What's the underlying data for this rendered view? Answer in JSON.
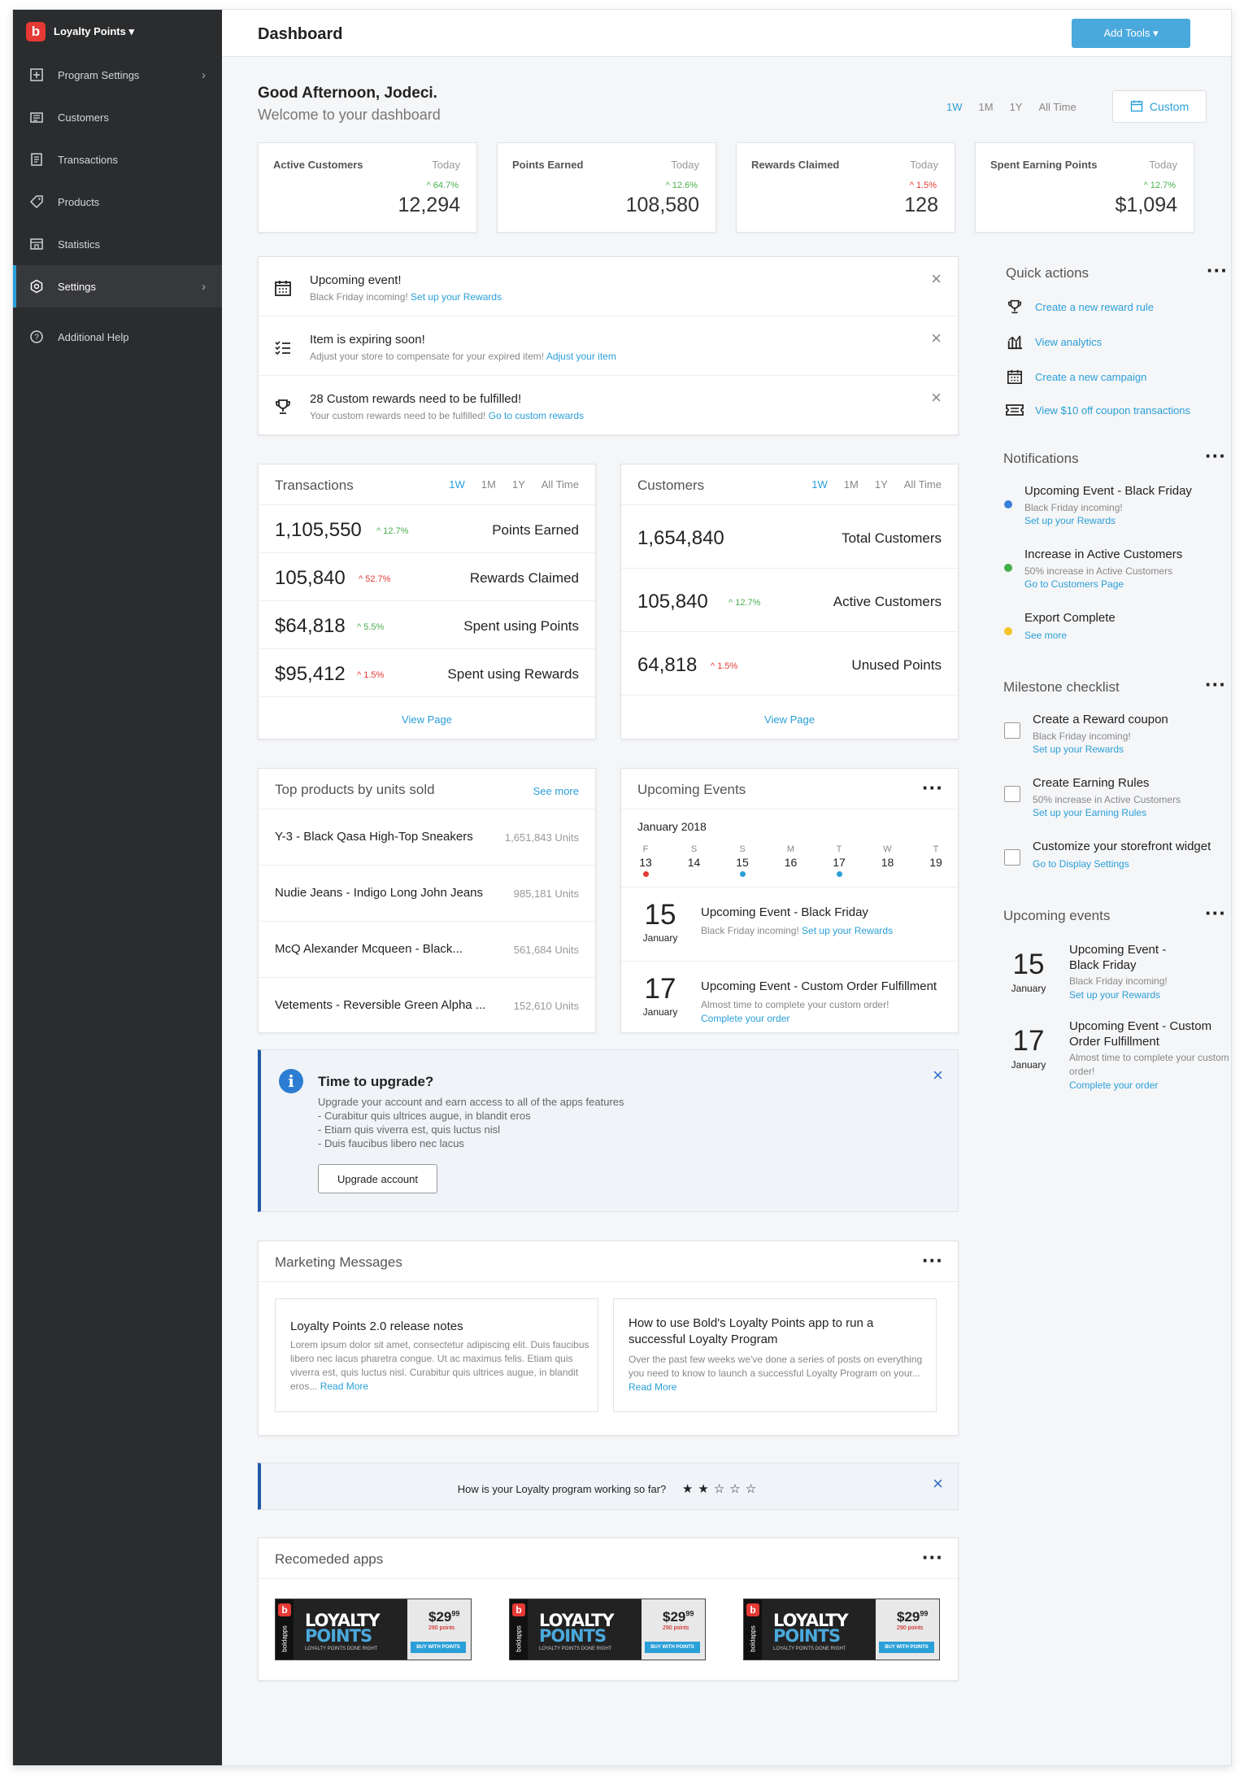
{
  "sidebar": {
    "brand": "Loyalty Points ▾",
    "items": [
      {
        "label": "Program Settings"
      },
      {
        "label": "Customers"
      },
      {
        "label": "Transactions"
      },
      {
        "label": "Products"
      },
      {
        "label": "Statistics"
      },
      {
        "label": "Settings"
      },
      {
        "label": "Additional Help"
      }
    ]
  },
  "header": {
    "title": "Dashboard",
    "add_tools": "Add Tools ▾"
  },
  "greeting": {
    "title": "Good Afternoon, Jodeci.",
    "subtitle": "Welcome to your dashboard"
  },
  "ranges": [
    "1W",
    "1M",
    "1Y",
    "All Time"
  ],
  "custom_label": "Custom",
  "stats": [
    {
      "label": "Active Customers",
      "period": "Today",
      "change": "^ 64.7%",
      "value": "12,294",
      "trend": "up"
    },
    {
      "label": "Points Earned",
      "period": "Today",
      "change": "^ 12.6%",
      "value": "108,580",
      "trend": "up"
    },
    {
      "label": "Rewards Claimed",
      "period": "Today",
      "change": "^ 1.5%",
      "value": "128",
      "trend": "down"
    },
    {
      "label": "Spent Earning Points",
      "period": "Today",
      "change": "^ 12.7%",
      "value": "$1,094",
      "trend": "up"
    }
  ],
  "alerts": [
    {
      "title": "Upcoming event!",
      "desc": "Black Friday incoming! ",
      "link": "Set up your Rewards"
    },
    {
      "title": "Item is expiring soon!",
      "desc": "Adjust your store to compensate for your expired item! ",
      "link": "Adjust your item"
    },
    {
      "title": "28 Custom rewards need to be fulfilled!",
      "desc": "Your custom rewards need to be fulfilled! ",
      "link": "Go to custom rewards"
    }
  ],
  "transactions": {
    "title": "Transactions",
    "rows": [
      {
        "value": "1,105,550",
        "change": "^ 12.7%",
        "trend": "up",
        "label": "Points Earned"
      },
      {
        "value": "105,840",
        "change": "^ 52.7%",
        "trend": "down",
        "label": "Rewards Claimed"
      },
      {
        "value": "$64,818",
        "change": "^ 5.5%",
        "trend": "up",
        "label": "Spent using Points"
      },
      {
        "value": "$95,412",
        "change": "^ 1.5%",
        "trend": "down",
        "label": "Spent using Rewards"
      }
    ],
    "view_page": "View Page"
  },
  "customers": {
    "title": "Customers",
    "rows": [
      {
        "value": "1,654,840",
        "change": "",
        "trend": "up",
        "label": "Total Customers"
      },
      {
        "value": "105,840",
        "change": "^ 12.7%",
        "trend": "up",
        "label": "Active Customers"
      },
      {
        "value": "64,818",
        "change": "^ 1.5%",
        "trend": "down",
        "label": "Unused Points"
      }
    ],
    "view_page": "View Page"
  },
  "top_products": {
    "title": "Top products by units sold",
    "see_more": "See more",
    "rows": [
      {
        "name": "Y-3 - Black Qasa High-Top Sneakers",
        "units": "1,651,843 Units"
      },
      {
        "name": "Nudie Jeans - Indigo Long John Jeans",
        "units": "985,181 Units"
      },
      {
        "name": "McQ Alexander Mcqueen - Black...",
        "units": "561,684 Units"
      },
      {
        "name": "Vetements - Reversible Green Alpha ...",
        "units": "152,610 Units"
      }
    ]
  },
  "upcoming_events": {
    "title": "Upcoming Events",
    "month": "January 2018",
    "days": [
      {
        "d": "F",
        "n": "13",
        "dot": "#e53935"
      },
      {
        "d": "S",
        "n": "14",
        "dot": ""
      },
      {
        "d": "S",
        "n": "15",
        "dot": "#2a9fd8"
      },
      {
        "d": "M",
        "n": "16",
        "dot": ""
      },
      {
        "d": "T",
        "n": "17",
        "dot": "#2a9fd8"
      },
      {
        "d": "W",
        "n": "18",
        "dot": ""
      },
      {
        "d": "T",
        "n": "19",
        "dot": ""
      }
    ],
    "events": [
      {
        "day": "15",
        "month": "January",
        "title": "Upcoming Event - Black Friday",
        "desc": "Black Friday incoming! ",
        "link": "Set up your Rewards"
      },
      {
        "day": "17",
        "month": "January",
        "title": "Upcoming Event - Custom Order Fulfillment",
        "desc": "Almost time to complete your custom order!",
        "link": "Complete your order"
      }
    ]
  },
  "upgrade": {
    "title": "Time to upgrade?",
    "lines": [
      "Upgrade your account and earn access to all of the apps features",
      "- Curabitur quis ultrices augue, in blandit eros",
      "- Etiam quis viverra est, quis luctus nisl",
      "- Duis faucibus libero nec lacus"
    ],
    "button": "Upgrade account"
  },
  "marketing": {
    "title": "Marketing Messages",
    "messages": [
      {
        "title": "Loyalty Points 2.0 release notes",
        "body": "Lorem ipsum dolor sit amet, consectetur adipiscing elit. Duis faucibus libero nec lacus pharetra congue. Ut ac maximus felis. Etiam quis viverra est, quis luctus nisl. Curabitur quis ultrices augue, in blandit eros... ",
        "link": "Read More"
      },
      {
        "title": "How to use Bold's Loyalty Points app to run a successful Loyalty Program",
        "body": "Over the past few weeks we've done a series of posts on everything you need to know to launch a successful Loyalty Program on your... ",
        "link": "Read More"
      }
    ]
  },
  "rating": {
    "question": "How is your Loyalty program working so far?",
    "stars": 2,
    "max": 5
  },
  "recommended": {
    "title": "Recomeded apps",
    "app": {
      "line1": "LOYALTY",
      "line2": "POINTS",
      "tag": "LOYALTY POINTS DONE RIGHT",
      "price": "$29",
      "cents": "99",
      "points": "290 points",
      "buy": "BUY WITH POINTS",
      "side": "boldapps"
    }
  },
  "quick_actions": {
    "title": "Quick actions",
    "items": [
      "Create a new reward rule",
      "View analytics",
      "Create a new campaign",
      "View $10 off coupon transactions"
    ]
  },
  "notifications": {
    "title": "Notifications",
    "items": [
      {
        "title": "Upcoming Event - Black Friday",
        "desc": "Black Friday incoming!",
        "link": "Set up your Rewards",
        "color": "#3a7fd9"
      },
      {
        "title": "Increase in Active Customers",
        "desc": "50% increase in Active Customers",
        "link": "Go to Customers Page",
        "color": "#43b049"
      },
      {
        "title": "Export Complete",
        "desc": "",
        "link": "See more",
        "color": "#f7c325"
      }
    ]
  },
  "milestones": {
    "title": "Milestone checklist",
    "items": [
      {
        "title": "Create a Reward coupon",
        "desc": "Black Friday incoming!",
        "link": "Set up your Rewards"
      },
      {
        "title": "Create Earning Rules",
        "desc": "50% increase in Active Customers",
        "link": "Set up your Earning Rules"
      },
      {
        "title": "Customize your storefront widget",
        "desc": "",
        "link": "Go to Display Settings"
      }
    ]
  },
  "side_events": {
    "title": "Upcoming events",
    "items": [
      {
        "day": "15",
        "month": "January",
        "title": "Upcoming Event - Black Friday",
        "desc": "Black Friday incoming!",
        "link": "Set up your Rewards"
      },
      {
        "day": "17",
        "month": "January",
        "title": "Upcoming Event - Custom Order Fulfillment",
        "desc": "Almost time to complete your custom order!",
        "link": "Complete your order"
      }
    ]
  }
}
